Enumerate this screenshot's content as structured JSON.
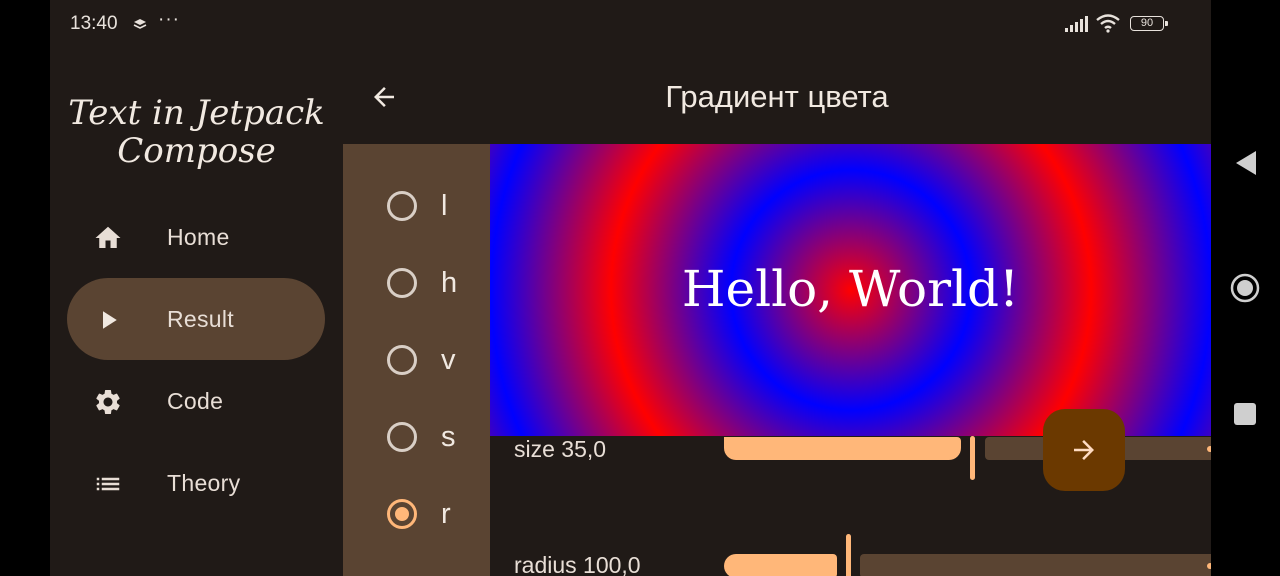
{
  "status_bar": {
    "time": "13:40",
    "battery": "90"
  },
  "drawer": {
    "title": "Text in Jetpack Compose",
    "items": [
      {
        "label": "Home",
        "icon": "home-icon"
      },
      {
        "label": "Result",
        "icon": "play-icon",
        "selected": true
      },
      {
        "label": "Code",
        "icon": "gear-icon"
      },
      {
        "label": "Theory",
        "icon": "list-icon"
      }
    ]
  },
  "topbar": {
    "title": "Градиент цвета"
  },
  "options": [
    {
      "label": "l",
      "checked": false
    },
    {
      "label": "h",
      "checked": false
    },
    {
      "label": "v",
      "checked": false
    },
    {
      "label": "s",
      "checked": false
    },
    {
      "label": "r",
      "checked": true
    }
  ],
  "preview": {
    "text": "Hello, World!",
    "gradient_colors": [
      "#ff0000",
      "#0000ff"
    ]
  },
  "sliders": [
    {
      "label": "size 35,0",
      "value": 35.0
    },
    {
      "label": "radius 100,0",
      "value": 100.0
    }
  ],
  "colors": {
    "background": "#201a17",
    "accent": "#ffb779",
    "container": "#5a4432",
    "fab": "#6b3900"
  }
}
